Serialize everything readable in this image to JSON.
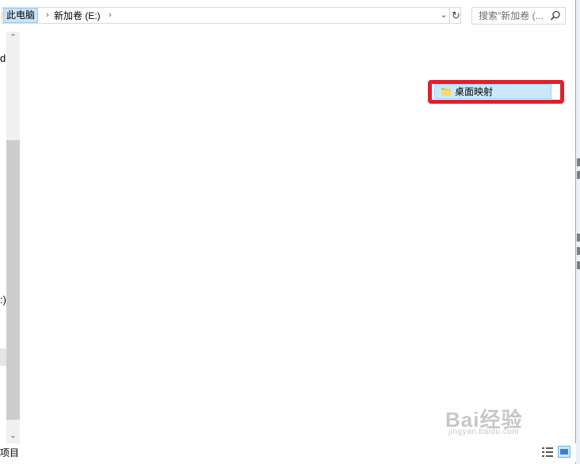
{
  "address_bar": {
    "breadcrumbs": [
      "此电脑",
      "新加卷 (E:)"
    ],
    "separator": "›",
    "dropdown_icon": "chevron-down-icon",
    "refresh_icon": "refresh-icon"
  },
  "search": {
    "placeholder": "搜索\"新加卷 (..."
  },
  "nav_pane": {
    "cut_text_1": "d",
    "cut_text_2": ":)"
  },
  "content": {
    "items": [
      {
        "label": "桌面映射",
        "icon": "folder-icon",
        "selected": true
      }
    ],
    "highlight_color": "#e0202a"
  },
  "status_bar": {
    "text": "项目"
  },
  "watermark": {
    "brand": "Bai经验",
    "url": "jingyan.baidu.com"
  }
}
